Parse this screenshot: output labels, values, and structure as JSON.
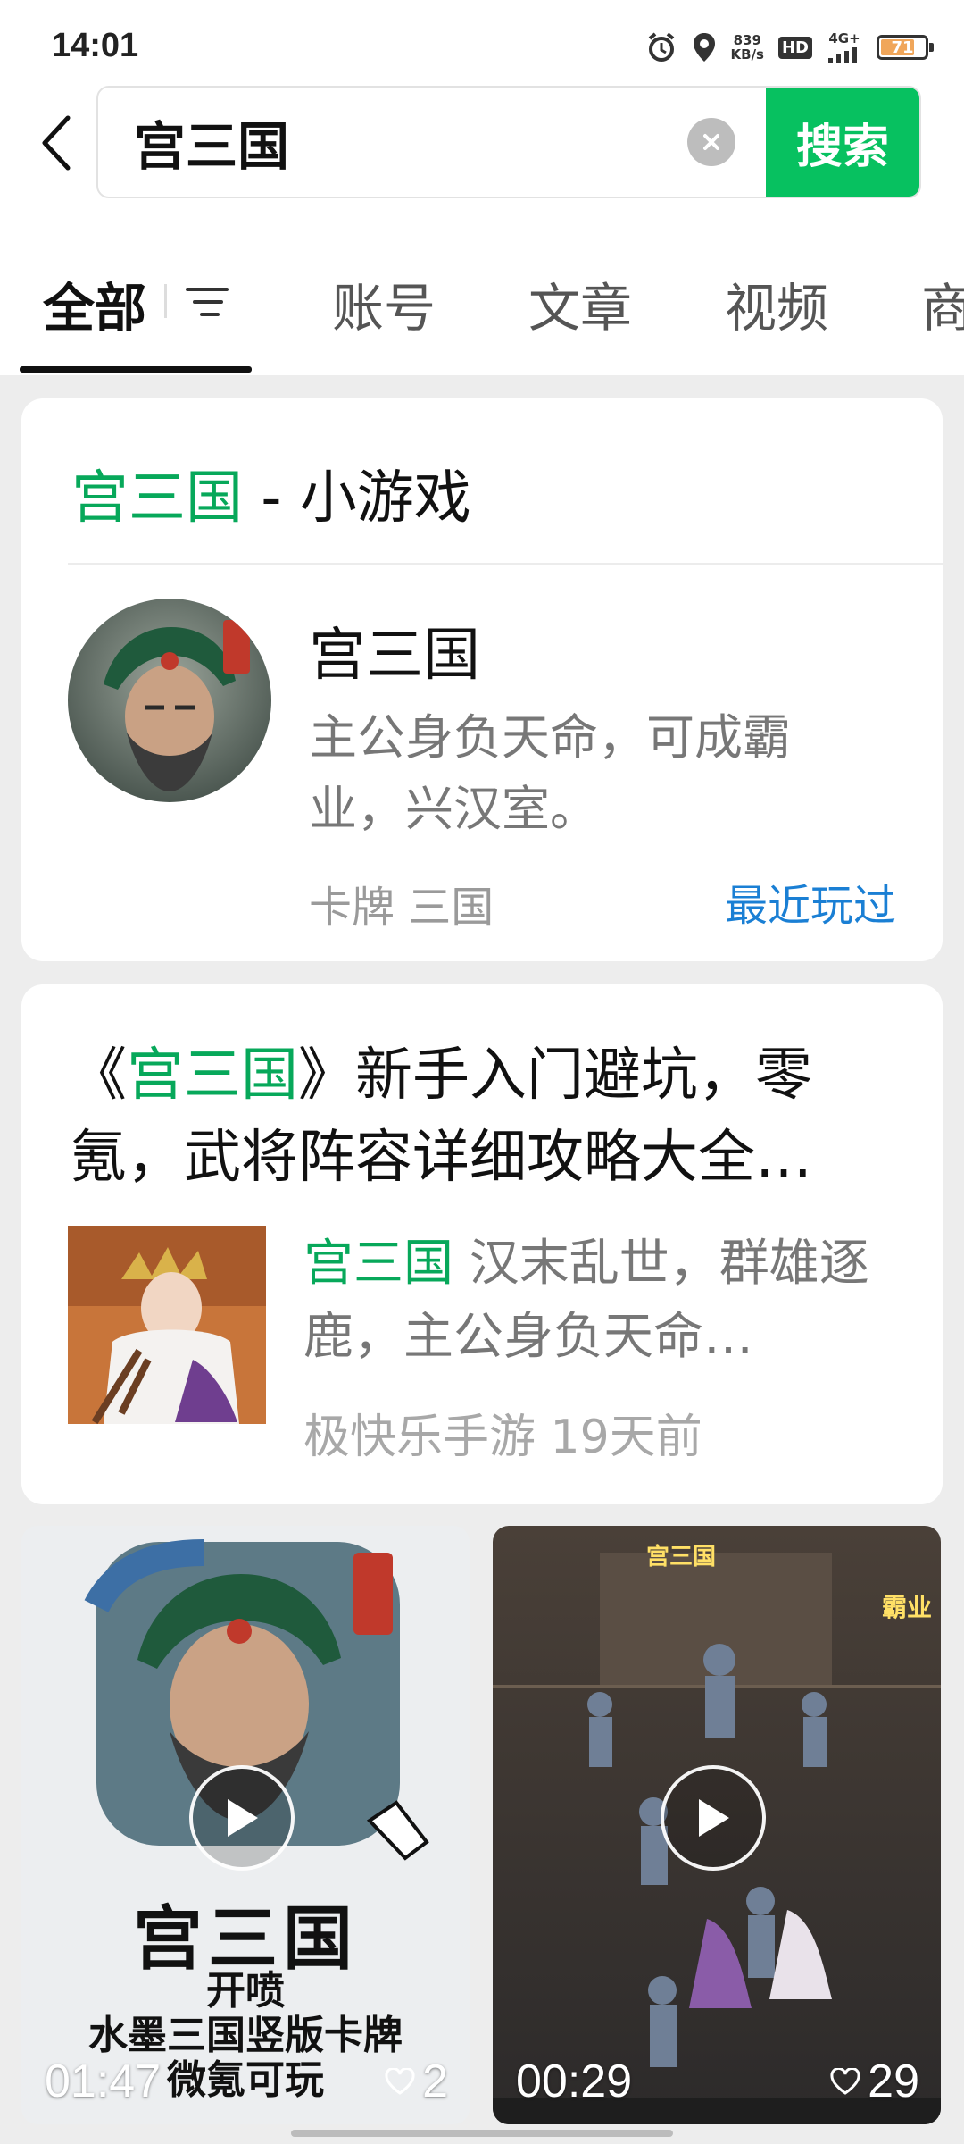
{
  "status_bar": {
    "time": "14:01",
    "net_speed_value": "839",
    "net_speed_unit": "KB/s",
    "hd": "HD",
    "network": "4G+",
    "battery": "71",
    "icons": [
      "alarm-icon",
      "location-icon",
      "signal-icon",
      "battery-icon"
    ]
  },
  "search": {
    "query": "宫三国",
    "button": "搜索"
  },
  "tabs": [
    {
      "label": "全部",
      "active": true
    },
    {
      "label": "账号"
    },
    {
      "label": "文章"
    },
    {
      "label": "视频"
    },
    {
      "label": "商"
    }
  ],
  "mini_game": {
    "header_keyword": "宫三国",
    "header_suffix": " - 小游戏",
    "name": "宫三国",
    "description": "主公身负天命，可成霸业，兴汉室。",
    "tags": "卡牌 三国",
    "action": "最近玩过"
  },
  "article": {
    "title_prefix": "《",
    "title_keyword": "宫三国",
    "title_rest": "》新手入门避坑，零氪，武将阵容详细攻略大全…",
    "snippet_keyword": "宫三国",
    "snippet_rest": " 汉末乱世，群雄逐鹿，主公身负天命…",
    "source": "极快乐手游",
    "age": "19天前"
  },
  "videos": [
    {
      "overlay_title": "宫三国",
      "overlay_line1": "开喷",
      "overlay_line2": "水墨三国竖版卡牌",
      "overlay_line3": "微氪可玩",
      "duration": "01:47",
      "likes": "2"
    },
    {
      "game_tag": "宫三国",
      "corner_tag": "霸业",
      "duration": "00:29",
      "likes": "29"
    }
  ],
  "colors": {
    "accent_green": "#07c160",
    "keyword_green": "#07a85a",
    "link_blue": "#1a7fd4"
  }
}
